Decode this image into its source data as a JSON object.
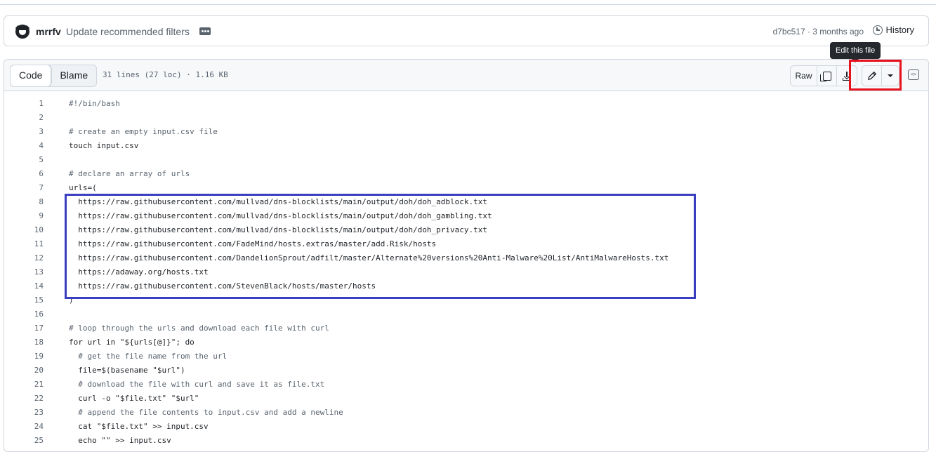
{
  "commit": {
    "author": "mrrfv",
    "message": "Update recommended filters",
    "sha_time": "d7bc517 · 3 months ago",
    "history_label": "History"
  },
  "file_header": {
    "tabs": [
      "Code",
      "Blame"
    ],
    "lines_info": "31 lines (27 loc) · 1.16 KB",
    "raw_label": "Raw",
    "tooltip": "Edit this file"
  },
  "code_lines": [
    {
      "n": "1",
      "text": "#!/bin/bash"
    },
    {
      "n": "2",
      "text": ""
    },
    {
      "n": "3",
      "text": "# create an empty input.csv file"
    },
    {
      "n": "4",
      "text": "touch input.csv"
    },
    {
      "n": "5",
      "text": ""
    },
    {
      "n": "6",
      "text": "# declare an array of urls"
    },
    {
      "n": "7",
      "text": "urls=("
    },
    {
      "n": "8",
      "text": "  https://raw.githubusercontent.com/mullvad/dns-blocklists/main/output/doh/doh_adblock.txt"
    },
    {
      "n": "9",
      "text": "  https://raw.githubusercontent.com/mullvad/dns-blocklists/main/output/doh/doh_gambling.txt"
    },
    {
      "n": "10",
      "text": "  https://raw.githubusercontent.com/mullvad/dns-blocklists/main/output/doh/doh_privacy.txt"
    },
    {
      "n": "11",
      "text": "  https://raw.githubusercontent.com/FadeMind/hosts.extras/master/add.Risk/hosts"
    },
    {
      "n": "12",
      "text": "  https://raw.githubusercontent.com/DandelionSprout/adfilt/master/Alternate%20versions%20Anti-Malware%20List/AntiMalwareHosts.txt"
    },
    {
      "n": "13",
      "text": "  https://adaway.org/hosts.txt"
    },
    {
      "n": "14",
      "text": "  https://raw.githubusercontent.com/StevenBlack/hosts/master/hosts"
    },
    {
      "n": "15",
      "text": ")"
    },
    {
      "n": "16",
      "text": ""
    },
    {
      "n": "17",
      "text": "# loop through the urls and download each file with curl"
    },
    {
      "n": "18",
      "text": "for url in \"${urls[@]}\"; do"
    },
    {
      "n": "19",
      "text": "  # get the file name from the url"
    },
    {
      "n": "20",
      "text": "  file=$(basename \"$url\")"
    },
    {
      "n": "21",
      "text": "  # download the file with curl and save it as file.txt"
    },
    {
      "n": "22",
      "text": "  curl -o \"$file.txt\" \"$url\""
    },
    {
      "n": "23",
      "text": "  # append the file contents to input.csv and add a newline"
    },
    {
      "n": "24",
      "text": "  cat \"$file.txt\" >> input.csv"
    },
    {
      "n": "25",
      "text": "  echo \"\" >> input.csv"
    }
  ]
}
